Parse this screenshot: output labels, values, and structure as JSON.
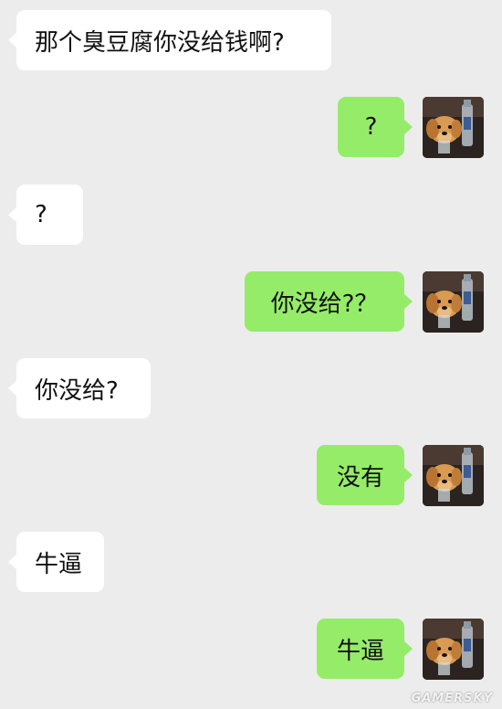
{
  "chat": {
    "messages": [
      {
        "side": "in",
        "text": "那个臭豆腐你没给钱啊?"
      },
      {
        "side": "out",
        "text": "?"
      },
      {
        "side": "in",
        "text": "?"
      },
      {
        "side": "out",
        "text": "你没给?？"
      },
      {
        "side": "in",
        "text": "你没给?"
      },
      {
        "side": "out",
        "text": "没有"
      },
      {
        "side": "in",
        "text": "牛逼"
      },
      {
        "side": "out",
        "text": "牛逼"
      }
    ]
  },
  "avatar": {
    "description_icon": "golden-retriever-with-bottle-avatar"
  },
  "watermark": "GAMERSKY",
  "colors": {
    "background": "#ececec",
    "incoming_bubble": "#ffffff",
    "outgoing_bubble": "#95ec69",
    "text": "#111111"
  }
}
